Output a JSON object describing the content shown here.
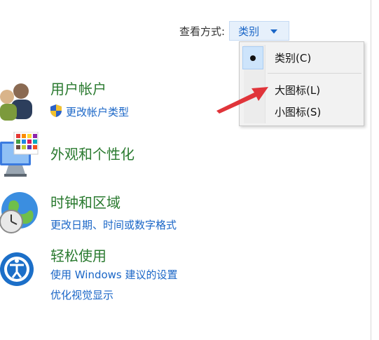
{
  "view_by": {
    "label": "查看方式:",
    "selected": "类别"
  },
  "menu": {
    "items": [
      {
        "label": "类别(C)",
        "checked": true
      },
      {
        "label": "大图标(L)",
        "checked": false
      },
      {
        "label": "小图标(S)",
        "checked": false
      }
    ]
  },
  "categories": [
    {
      "title": "用户帐户",
      "icon": "users-icon",
      "links": [
        "更改帐户类型"
      ],
      "link_icon": "uac-shield-icon"
    },
    {
      "title": "外观和个性化",
      "icon": "monitor-palette-icon",
      "links": []
    },
    {
      "title": "时钟和区域",
      "icon": "clock-globe-icon",
      "links": [
        "更改日期、时间或数字格式"
      ]
    },
    {
      "title": "轻松使用",
      "icon": "ease-of-access-icon",
      "links": [
        "使用 Windows 建议的设置",
        "优化视觉显示"
      ]
    }
  ],
  "annotation": {
    "icon": "red-arrow-icon",
    "color": "#e0343a"
  },
  "colors": {
    "link": "#1a66c7",
    "category_title": "#2a7a2f",
    "menu_highlight": "#cde4fb"
  }
}
